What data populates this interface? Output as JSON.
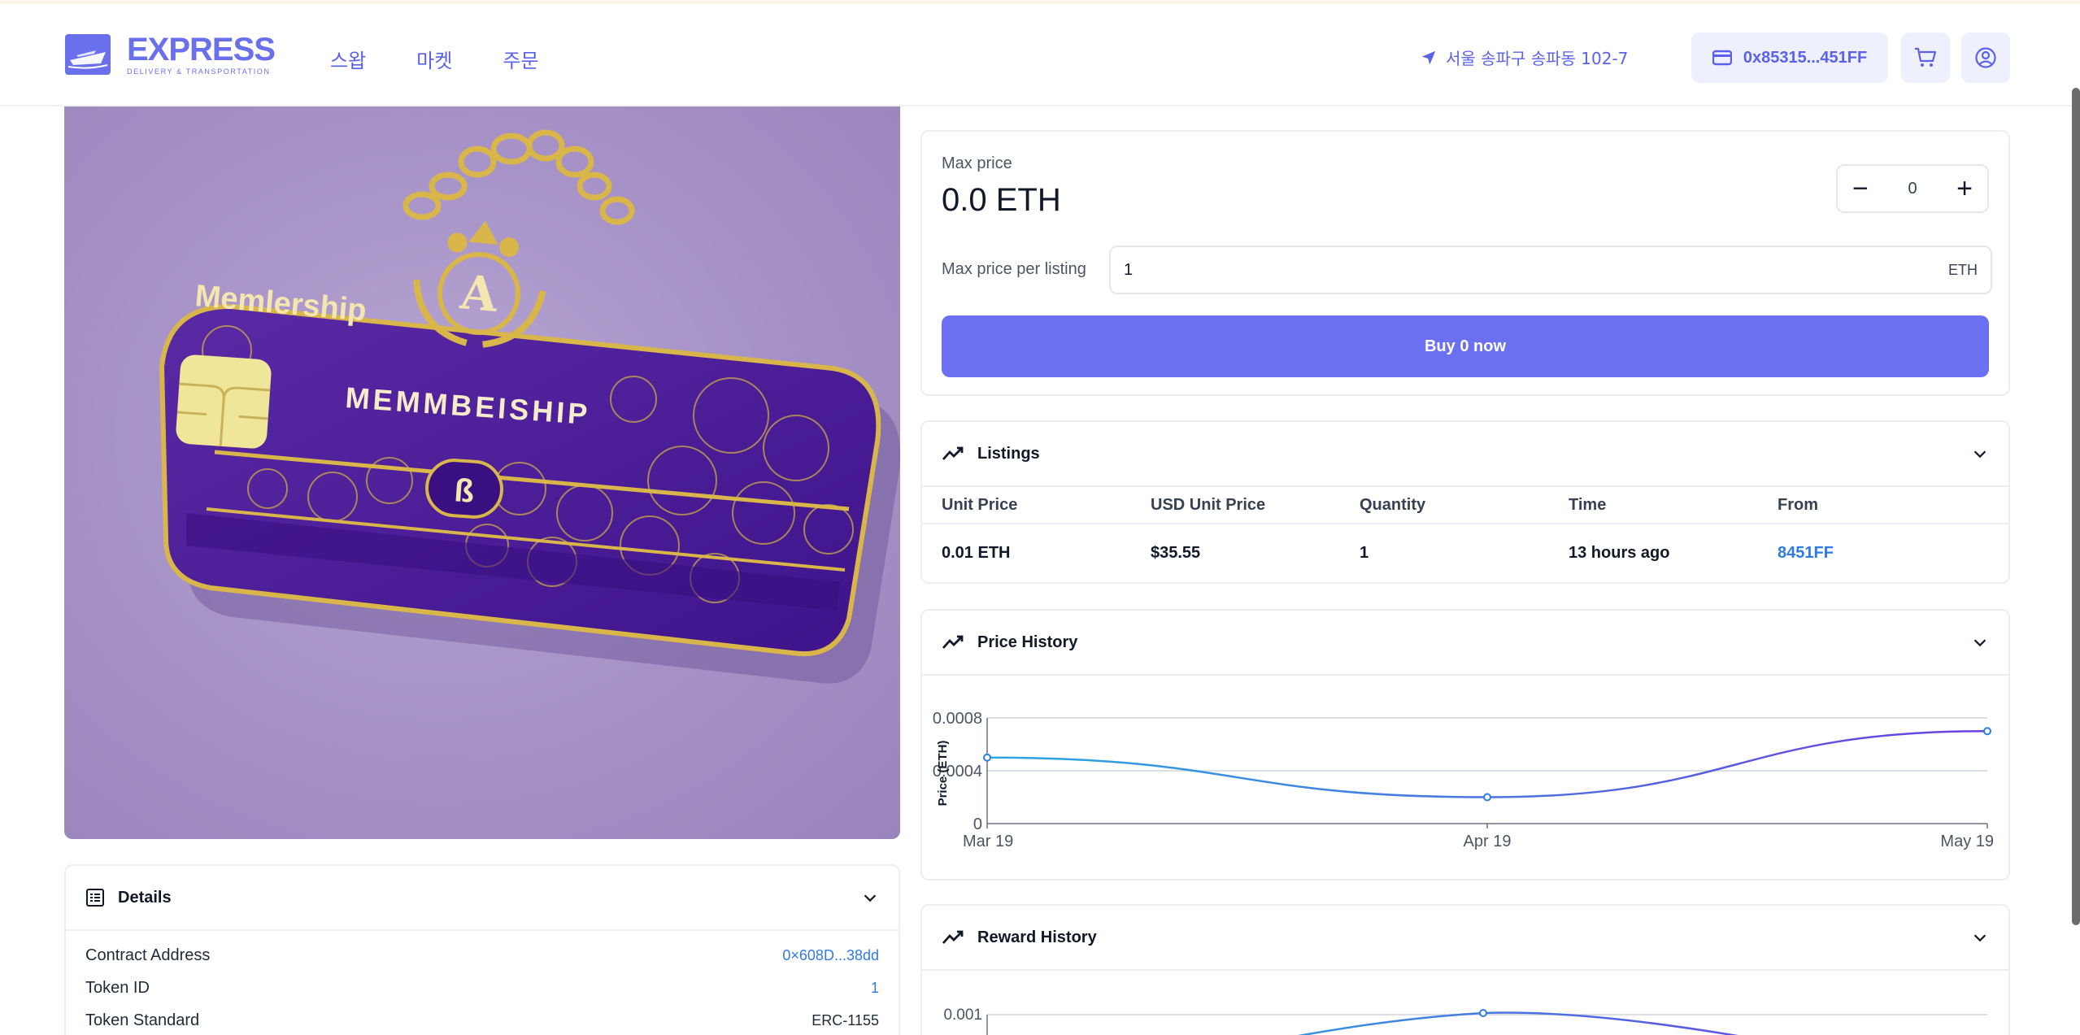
{
  "header": {
    "brand_title": "EXPRESS",
    "brand_sub": "DELIVERY & TRANSPORTATION",
    "nav": [
      "스왑",
      "마켓",
      "주문"
    ],
    "location": "서울 송파구 송파동 102-7",
    "wallet": "0x85315...451FF",
    "accent": "#6a6fec"
  },
  "nft_image": {
    "texts": [
      "Memlership",
      "MEMMBEISHIP",
      "A",
      "ß"
    ]
  },
  "details": {
    "title": "Details",
    "rows": [
      {
        "key": "Contract Address",
        "value": "0×608D...38dd"
      },
      {
        "key": "Token ID",
        "value": "1"
      },
      {
        "key": "Token Standard",
        "value": "ERC-1155"
      }
    ]
  },
  "buy": {
    "max_price_label": "Max price",
    "max_price_value": "0.0 ETH",
    "quantity": "0",
    "per_listing_label": "Max price per listing",
    "per_listing_value": "1",
    "unit": "ETH",
    "button_label": "Buy 0 now",
    "button_color": "#6b70f0"
  },
  "listings": {
    "title": "Listings",
    "columns": [
      "Unit Price",
      "USD Unit Price",
      "Quantity",
      "Time",
      "From"
    ],
    "rows": [
      [
        "0.01 ETH",
        "$35.55",
        "1",
        "13 hours ago",
        "8451FF"
      ]
    ]
  },
  "price_history": {
    "title": "Price History",
    "chart_data": {
      "type": "line",
      "x": [
        "Mar 19",
        "Apr 19",
        "May 19"
      ],
      "series": [
        {
          "values": [
            0.0005,
            0.0002,
            0.0007
          ]
        }
      ],
      "ylabel": "Price (ETH)",
      "yticks": [
        "0",
        "0.0004",
        "0.0008"
      ],
      "ylim": [
        0,
        0.0008
      ]
    }
  },
  "reward_history": {
    "title": "Reward History",
    "ytick_top": "0.001"
  }
}
